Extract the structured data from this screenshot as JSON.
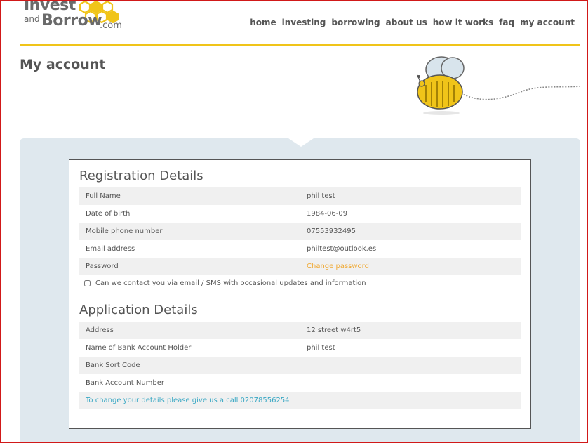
{
  "brand": {
    "logo_line1": "Invest",
    "logo_and": "and",
    "logo_line2": "Borrow",
    "logo_com": ".com",
    "accent": "#f0c419"
  },
  "nav": {
    "items": [
      "home",
      "investing",
      "borrowing",
      "about us",
      "how it works",
      "faq",
      "my account"
    ]
  },
  "page": {
    "title": "My account"
  },
  "registration": {
    "title": "Registration Details",
    "rows": [
      {
        "label": "Full Name",
        "value": "phil test"
      },
      {
        "label": "Date of birth",
        "value": "1984-06-09"
      },
      {
        "label": "Mobile phone number",
        "value": "07553932495"
      },
      {
        "label": "Email address",
        "value": "philtest@outlook.es"
      },
      {
        "label": "Password",
        "value": "Change password"
      }
    ],
    "consent_label": "Can we contact you via email / SMS with occasional updates and information"
  },
  "application": {
    "title": "Application Details",
    "rows": [
      {
        "label": "Address",
        "value": "12 street w4rt5"
      },
      {
        "label": "Name of Bank Account Holder",
        "value": "phil test"
      },
      {
        "label": "Bank Sort Code",
        "value": ""
      },
      {
        "label": "Bank Account Number",
        "value": ""
      }
    ],
    "contact_note": "To change your details please give us a call 02078556254"
  },
  "icons": {
    "logo_mark": "honeycomb-icon",
    "mascot": "bee-icon"
  }
}
